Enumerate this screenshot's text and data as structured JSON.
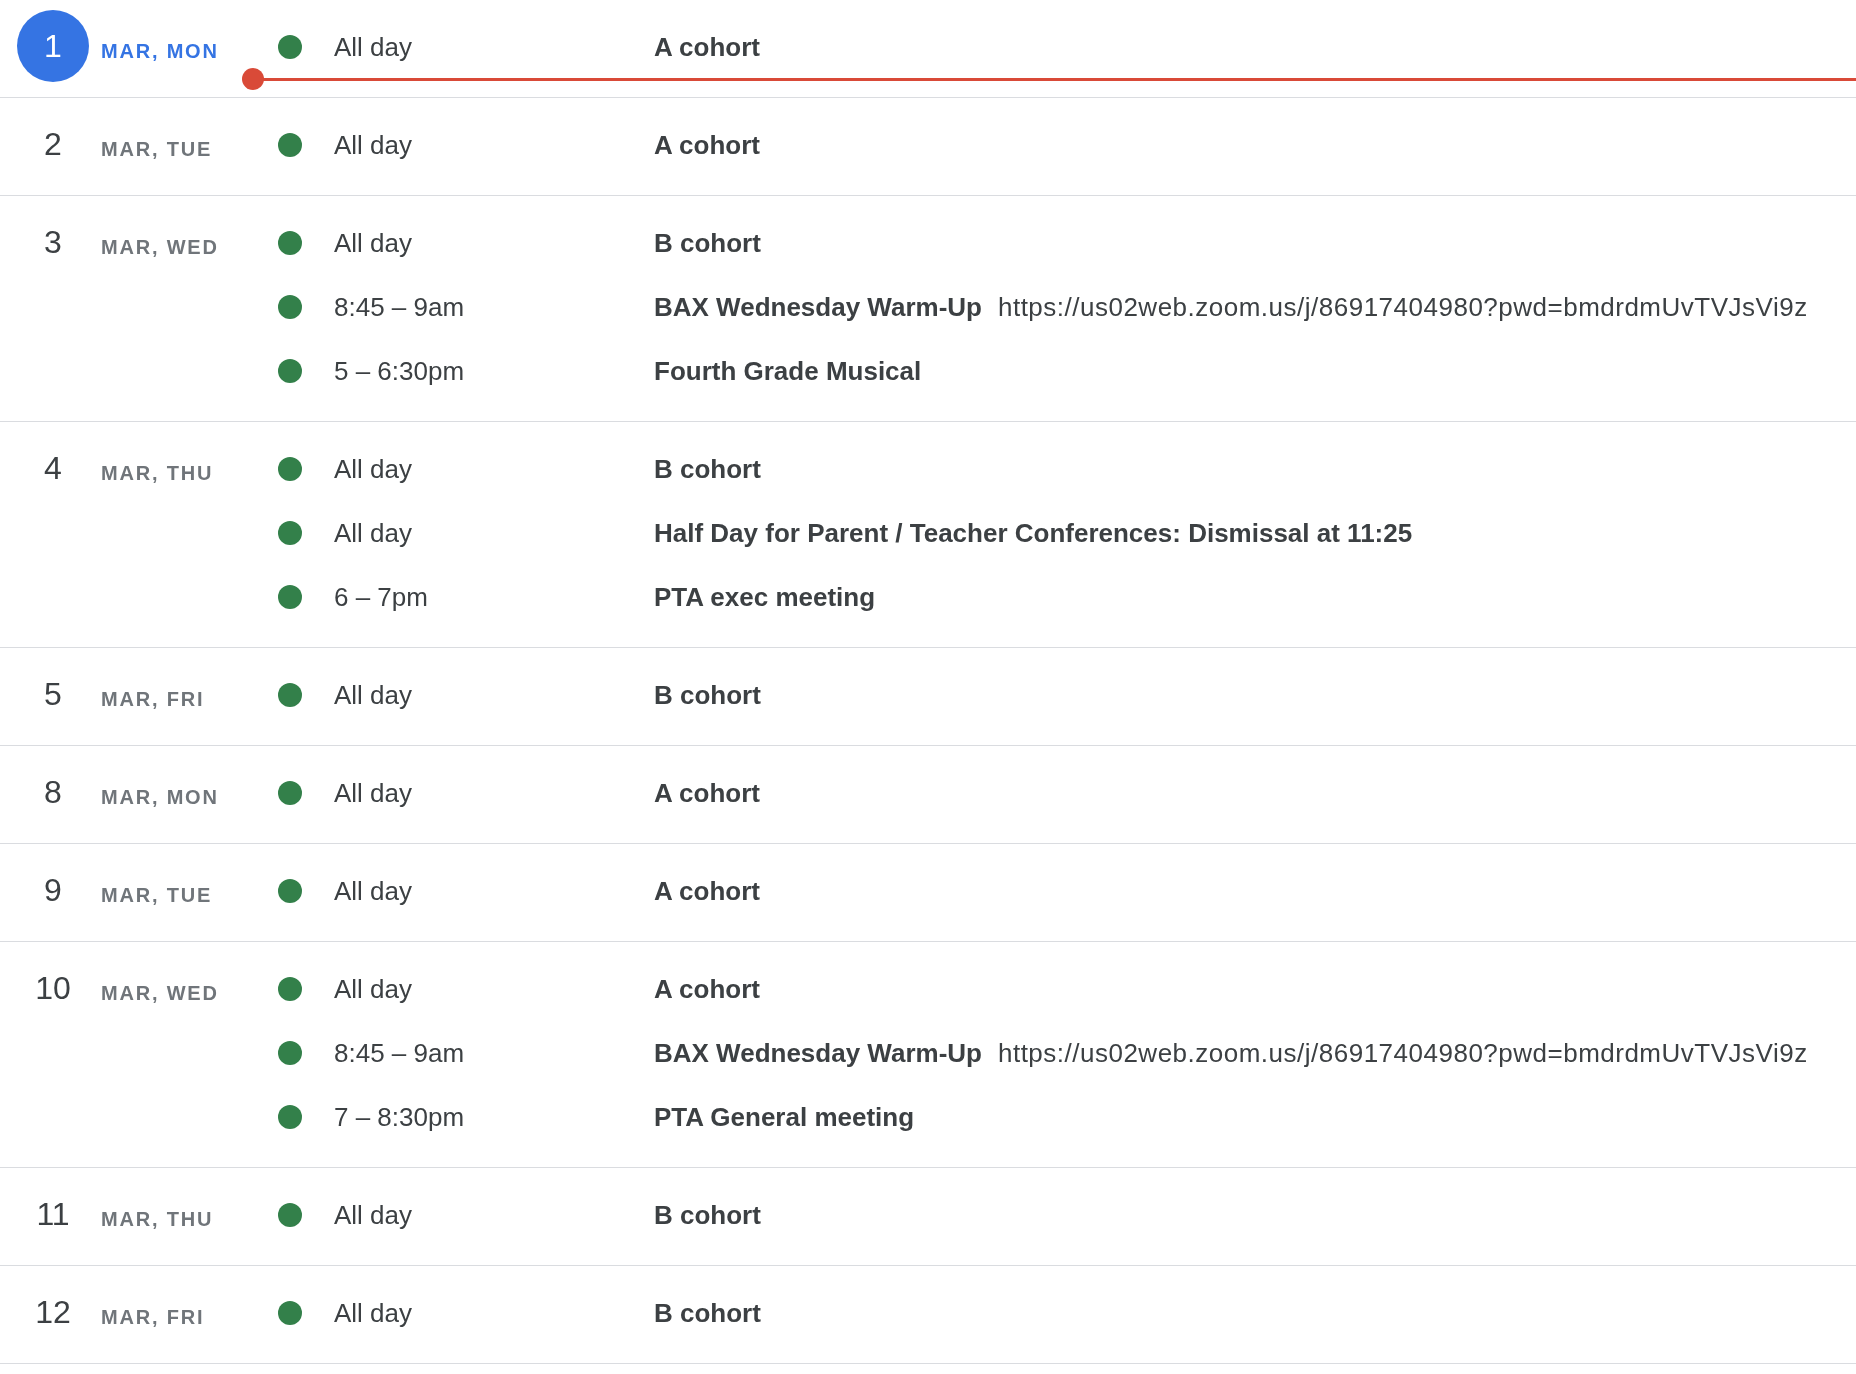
{
  "days": [
    {
      "number": "1",
      "label": "MAR, MON",
      "today": true,
      "now_line": true,
      "events": [
        {
          "time": "All day",
          "title": "A cohort"
        }
      ]
    },
    {
      "number": "2",
      "label": "MAR, TUE",
      "today": false,
      "now_line": false,
      "events": [
        {
          "time": "All day",
          "title": "A cohort"
        }
      ]
    },
    {
      "number": "3",
      "label": "MAR, WED",
      "today": false,
      "now_line": false,
      "events": [
        {
          "time": "All day",
          "title": "B cohort"
        },
        {
          "time": "8:45 – 9am",
          "title": "BAX Wednesday Warm-Up",
          "description": "https://us02web.zoom.us/j/86917404980?pwd=bmdrdmUvTVJsVi9z"
        },
        {
          "time": "5 – 6:30pm",
          "title": "Fourth Grade Musical"
        }
      ]
    },
    {
      "number": "4",
      "label": "MAR, THU",
      "today": false,
      "now_line": false,
      "events": [
        {
          "time": "All day",
          "title": "B cohort"
        },
        {
          "time": "All day",
          "title": "Half Day for Parent / Teacher Conferences: Dismissal at 11:25"
        },
        {
          "time": "6 – 7pm",
          "title": "PTA exec meeting"
        }
      ]
    },
    {
      "number": "5",
      "label": "MAR, FRI",
      "today": false,
      "now_line": false,
      "events": [
        {
          "time": "All day",
          "title": "B cohort"
        }
      ]
    },
    {
      "number": "8",
      "label": "MAR, MON",
      "today": false,
      "now_line": false,
      "events": [
        {
          "time": "All day",
          "title": "A cohort"
        }
      ]
    },
    {
      "number": "9",
      "label": "MAR, TUE",
      "today": false,
      "now_line": false,
      "events": [
        {
          "time": "All day",
          "title": "A cohort"
        }
      ]
    },
    {
      "number": "10",
      "label": "MAR, WED",
      "today": false,
      "now_line": false,
      "events": [
        {
          "time": "All day",
          "title": "A cohort"
        },
        {
          "time": "8:45 – 9am",
          "title": "BAX Wednesday Warm-Up",
          "description": "https://us02web.zoom.us/j/86917404980?pwd=bmdrdmUvTVJsVi9z"
        },
        {
          "time": "7 – 8:30pm",
          "title": "PTA General meeting"
        }
      ]
    },
    {
      "number": "11",
      "label": "MAR, THU",
      "today": false,
      "now_line": false,
      "events": [
        {
          "time": "All day",
          "title": "B cohort"
        }
      ]
    },
    {
      "number": "12",
      "label": "MAR, FRI",
      "today": false,
      "now_line": false,
      "events": [
        {
          "time": "All day",
          "title": "B cohort"
        }
      ]
    }
  ]
}
